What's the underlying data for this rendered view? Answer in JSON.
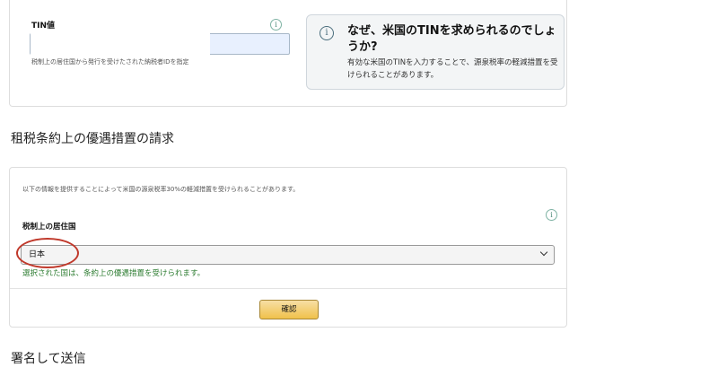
{
  "tin_section": {
    "label": "TIN値",
    "help": "税制上の居住国から発行を受けたされた納税者IDを指定",
    "info_icon": "info-icon",
    "input_value": ""
  },
  "why_box": {
    "icon": "info-icon",
    "title": "なぜ、米国のTINを求められるのでしょうか?",
    "body": "有効な米国のTINを入力することで、源泉税率の軽減措置を受けられることがあります。"
  },
  "treaty_section": {
    "title": "租税条約上の優遇措置の請求",
    "description": "以下の情報を提供することによって米国の源泉税率30%の軽減措置を受けられることがあります。",
    "info_icon": "info-icon",
    "residence_label": "税制上の居住国",
    "residence_value": "日本",
    "note": "選択された国は、条約上の優遇措置を受けられます。",
    "confirm_label": "確認"
  },
  "sign_section": {
    "title": "署名して送信"
  },
  "colors": {
    "note_green": "#2e7d32",
    "annotation_red": "#c0392b",
    "button_yellow": "#f0c14b"
  }
}
